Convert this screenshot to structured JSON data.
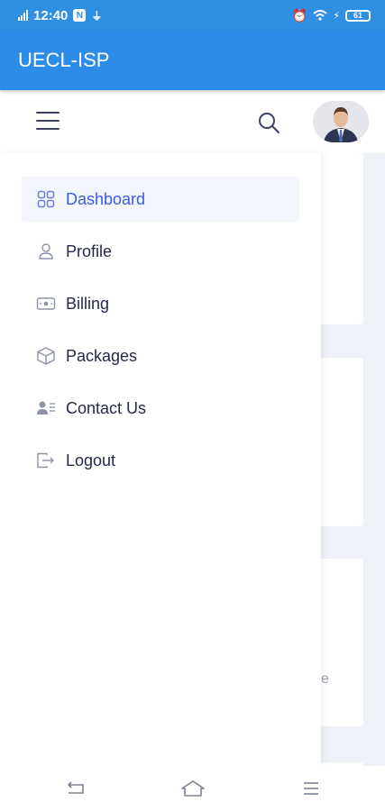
{
  "status_bar": {
    "network": "4G",
    "time": "12:40",
    "notification_badge": "N",
    "battery": "61"
  },
  "app": {
    "title": "UECL-ISP"
  },
  "menu": {
    "items": [
      {
        "label": "Dashboard",
        "icon": "grid-icon",
        "active": true
      },
      {
        "label": "Profile",
        "icon": "user-icon",
        "active": false
      },
      {
        "label": "Billing",
        "icon": "banknote-icon",
        "active": false
      },
      {
        "label": "Packages",
        "icon": "box-icon",
        "active": false
      },
      {
        "label": "Contact Us",
        "icon": "contacts-icon",
        "active": false
      },
      {
        "label": "Logout",
        "icon": "logout-icon",
        "active": false
      }
    ]
  },
  "background": {
    "partial_text": "e"
  },
  "colors": {
    "status_bar": "#2f8fe3",
    "app_bar": "#2d8ce8",
    "active_text": "#3b5bdb",
    "active_bg": "#f3f6fd",
    "nav_text": "#25294a",
    "icon_color": "#8c93a8"
  }
}
